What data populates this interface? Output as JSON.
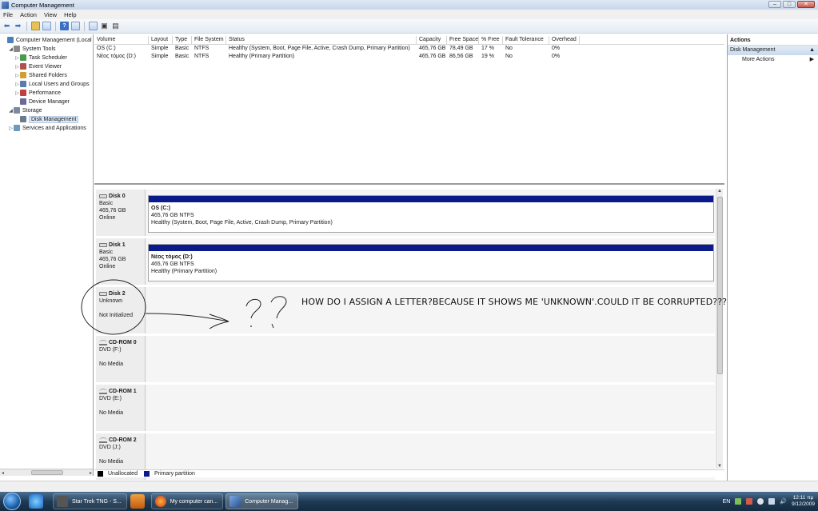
{
  "window": {
    "title": "Computer Management"
  },
  "menu": [
    "File",
    "Action",
    "View",
    "Help"
  ],
  "tree": [
    {
      "label": "Computer Management (Local",
      "icon": "computer-icon",
      "exp": "",
      "indent": 0
    },
    {
      "label": "System Tools",
      "icon": "tools-icon",
      "exp": "◢",
      "indent": 1
    },
    {
      "label": "Task Scheduler",
      "icon": "clock-icon",
      "exp": "▷",
      "indent": 2
    },
    {
      "label": "Event Viewer",
      "icon": "event-viewer-icon",
      "exp": "▷",
      "indent": 2
    },
    {
      "label": "Shared Folders",
      "icon": "shared-folder-icon",
      "exp": "▷",
      "indent": 2
    },
    {
      "label": "Local Users and Groups",
      "icon": "users-icon",
      "exp": "▷",
      "indent": 2
    },
    {
      "label": "Performance",
      "icon": "performance-icon",
      "exp": "▷",
      "indent": 2
    },
    {
      "label": "Device Manager",
      "icon": "device-manager-icon",
      "exp": "",
      "indent": 2
    },
    {
      "label": "Storage",
      "icon": "storage-icon",
      "exp": "◢",
      "indent": 1
    },
    {
      "label": "Disk Management",
      "icon": "disk-management-icon",
      "exp": "",
      "indent": 2,
      "selected": true
    },
    {
      "label": "Services and Applications",
      "icon": "services-icon",
      "exp": "▷",
      "indent": 1
    }
  ],
  "volumes": {
    "headers": [
      "Volume",
      "Layout",
      "Type",
      "File System",
      "Status",
      "Capacity",
      "Free Space",
      "% Free",
      "Fault Tolerance",
      "Overhead"
    ],
    "rows": [
      [
        "OS (C:)",
        "Simple",
        "Basic",
        "NTFS",
        "Healthy (System, Boot, Page File, Active, Crash Dump, Primary Partition)",
        "465,76 GB",
        "78,49 GB",
        "17 %",
        "No",
        "0%"
      ],
      [
        "Νέος τόμος (D:)",
        "Simple",
        "Basic",
        "NTFS",
        "Healthy (Primary Partition)",
        "465,76 GB",
        "86,56 GB",
        "19 %",
        "No",
        "0%"
      ]
    ]
  },
  "disks": [
    {
      "name": "Disk 0",
      "lines": [
        "Basic",
        "465,76 GB",
        "Online"
      ],
      "volume": {
        "name": "OS  (C:)",
        "size": "465,76 GB NTFS",
        "status": "Healthy (System, Boot, Page File, Active, Crash Dump, Primary Partition)"
      }
    },
    {
      "name": "Disk 1",
      "lines": [
        "Basic",
        "465,76 GB",
        "Online"
      ],
      "volume": {
        "name": "Νέος τόμος  (D:)",
        "size": "465,76 GB NTFS",
        "status": "Healthy (Primary Partition)"
      }
    },
    {
      "name": "Disk 2",
      "lines": [
        "Unknown",
        "",
        "Not Initialized"
      ]
    },
    {
      "name": "CD-ROM 0",
      "lines": [
        "DVD (F:)",
        "",
        "No Media"
      ]
    },
    {
      "name": "CD-ROM 1",
      "lines": [
        "DVD (E:)",
        "",
        "No Media"
      ]
    },
    {
      "name": "CD-ROM 2",
      "lines": [
        "DVD (J:)",
        "",
        "No Media"
      ]
    }
  ],
  "legend": {
    "unallocated": "Unallocated",
    "primary": "Primary partition",
    "unallocated_color": "#000000",
    "primary_color": "#0a1a8a"
  },
  "annotation": "HOW DO I ASSIGN A LETTER?BECAUSE IT SHOWS ME 'UNKNOWN'.COULD IT BE CORRUPTED??????",
  "actions": {
    "header": "Actions",
    "section": "Disk Management",
    "item": "More Actions"
  },
  "taskbar": {
    "tasks": [
      "Star Trek TNG - S...",
      "My computer can...",
      "Computer Manag..."
    ],
    "lang": "EN",
    "time": "12:11 πμ",
    "date": "9/12/2009"
  }
}
